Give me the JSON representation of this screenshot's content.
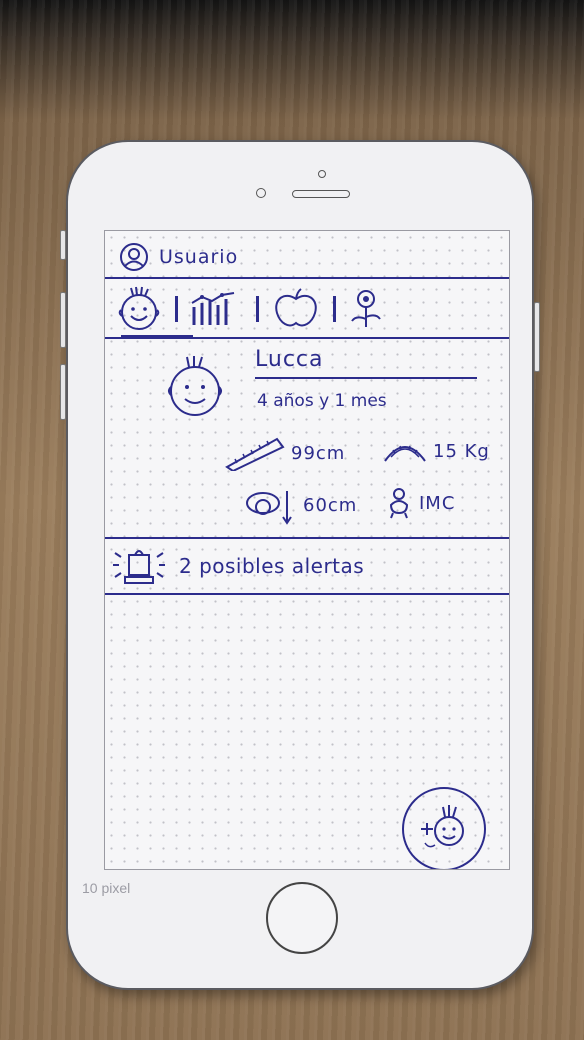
{
  "header": {
    "user_label": "Usuario"
  },
  "nav": {
    "tabs": [
      "child-profile",
      "growth-chart",
      "nutrition",
      "development"
    ]
  },
  "profile": {
    "name": "Lucca",
    "age": "4 años y 1 mes",
    "height": "99cm",
    "weight": "15 Kg",
    "head_circumference": "60cm",
    "bmi": "IMC"
  },
  "alerts": {
    "text": "2 posibles alertas"
  },
  "footer": {
    "pixel_label": "10 pixel"
  },
  "colors": {
    "ink": "#2c2c8c",
    "paper": "#f6f6f8",
    "phone_border": "#5b5b60"
  },
  "icons": [
    "user-icon",
    "baby-face-icon",
    "bar-chart-icon",
    "apple-icon",
    "flower-icon",
    "ruler-icon",
    "scale-icon",
    "head-measure-icon",
    "body-icon",
    "alarm-icon",
    "add-child-icon"
  ]
}
